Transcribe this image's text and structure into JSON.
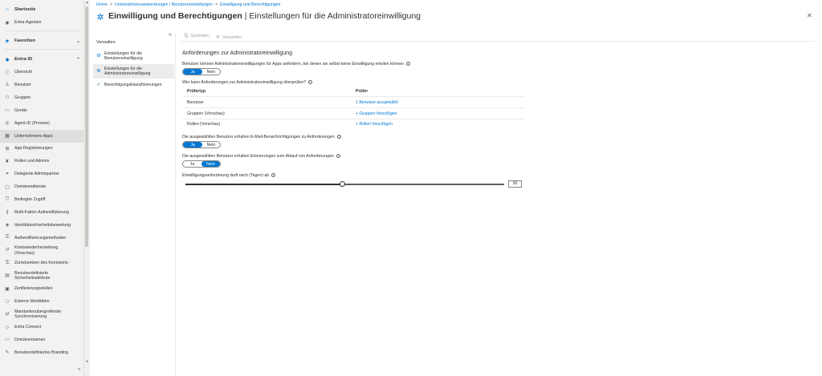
{
  "leftnav": {
    "home": "Startseite",
    "agents": "Entra-Agenten",
    "favorites": "Favoriten",
    "entra_id": "Entra ID",
    "items": [
      {
        "label": "Übersicht",
        "icon": "info-icon"
      },
      {
        "label": "Benutzer",
        "icon": "user-icon"
      },
      {
        "label": "Gruppen",
        "icon": "group-icon"
      },
      {
        "label": "Geräte",
        "icon": "device-icon"
      },
      {
        "label": "Agent-ID (Preview)",
        "icon": "agent-icon"
      },
      {
        "label": "Unternehmens-Apps",
        "icon": "apps-icon"
      },
      {
        "label": "App-Registrierungen",
        "icon": "app-registration-icon"
      },
      {
        "label": "Rollen und Admins",
        "icon": "roles-icon"
      },
      {
        "label": "Delegierte Adminpartner",
        "icon": "partner-icon"
      },
      {
        "label": "Domänendienste",
        "icon": "domain-services-icon"
      },
      {
        "label": "Bedingter Zugriff",
        "icon": "conditional-access-icon"
      },
      {
        "label": "Multi-Faktor-Authentifizierung",
        "icon": "mfa-icon"
      },
      {
        "label": "Identitätssicherheitsbewertung",
        "icon": "score-icon"
      },
      {
        "label": "Authentifizierungsmethoden",
        "icon": "key-icon"
      },
      {
        "label": "Kontowiederherstellung (Vorschau)",
        "icon": "recovery-icon"
      },
      {
        "label": "Zurücksetzen des Kennworts",
        "icon": "password-icon"
      },
      {
        "label": "Benutzerdefinierte Sicherheitsattribute",
        "icon": "attribute-icon"
      },
      {
        "label": "Zertifizierungsstellen",
        "icon": "certificate-icon"
      },
      {
        "label": "Externe Identitäten",
        "icon": "external-identity-icon"
      },
      {
        "label": "Mandantenübergreifende Synchronisierung",
        "icon": "sync-icon"
      },
      {
        "label": "Entra Connect",
        "icon": "connect-icon"
      },
      {
        "label": "Domänennamen",
        "icon": "domain-names-icon"
      },
      {
        "label": "Benutzerdefiniertes Branding",
        "icon": "branding-icon"
      }
    ]
  },
  "breadcrumb": [
    "Home",
    "Unternehmensanwendungen | Benutzereinstellungen",
    "Einwilligung und Berechtigungen"
  ],
  "title": {
    "main": "Einwilligung und Berechtigungen",
    "sub": " | Einstellungen für die Administratoreinwilligung"
  },
  "subnav": {
    "title": "Verwalten",
    "items": [
      {
        "label": "Einstellungen für die Benutzereinwilligung"
      },
      {
        "label": "Einstellungen für die Administratoreinwilligung"
      },
      {
        "label": "Berechtigungsklassifizierungen"
      }
    ]
  },
  "toolbar": {
    "save": "Speichern",
    "discard": "Verwerfen"
  },
  "content": {
    "section_title": "Anforderungen zur Administratoreinwilligung",
    "q1": "Benutzer können Administratoreinwilligungen für Apps anfordern, bei denen sie selbst keine Einwilligung erteilen können",
    "q1_toggle": {
      "yes": "Ja",
      "no": "Nein",
      "selected": "Ja"
    },
    "q2": "Wer kann Anforderungen zur Administratoreinwilligung überprüfen?",
    "table": {
      "headers": [
        "Prüfertyp",
        "Prüfer"
      ],
      "rows": [
        {
          "type": "Benutzer",
          "reviewer": "1 Benutzer ausgewählt"
        },
        {
          "type": "Gruppen (Vorschau)",
          "reviewer": "+ Gruppen hinzufügen"
        },
        {
          "type": "Rollen (Vorschau)",
          "reviewer": "+ Rollen hinzufügen"
        }
      ]
    },
    "q3": "Die ausgewählten Benutzer erhalten E-Mail-Benachrichtigungen zu Anforderungen",
    "q3_toggle": {
      "yes": "Ja",
      "no": "Nein",
      "selected": "Ja"
    },
    "q4": "Die ausgewählten Benutzer erhalten Erinnerungen zum Ablauf von Anforderungen",
    "q4_toggle": {
      "yes": "Ja",
      "no": "Nein",
      "selected": "Nein"
    },
    "q5": "Einwilligungsanforderung läuft nach (Tagen) ab",
    "slider": {
      "value": "30",
      "min": 1,
      "max": 60,
      "current": 30
    }
  }
}
